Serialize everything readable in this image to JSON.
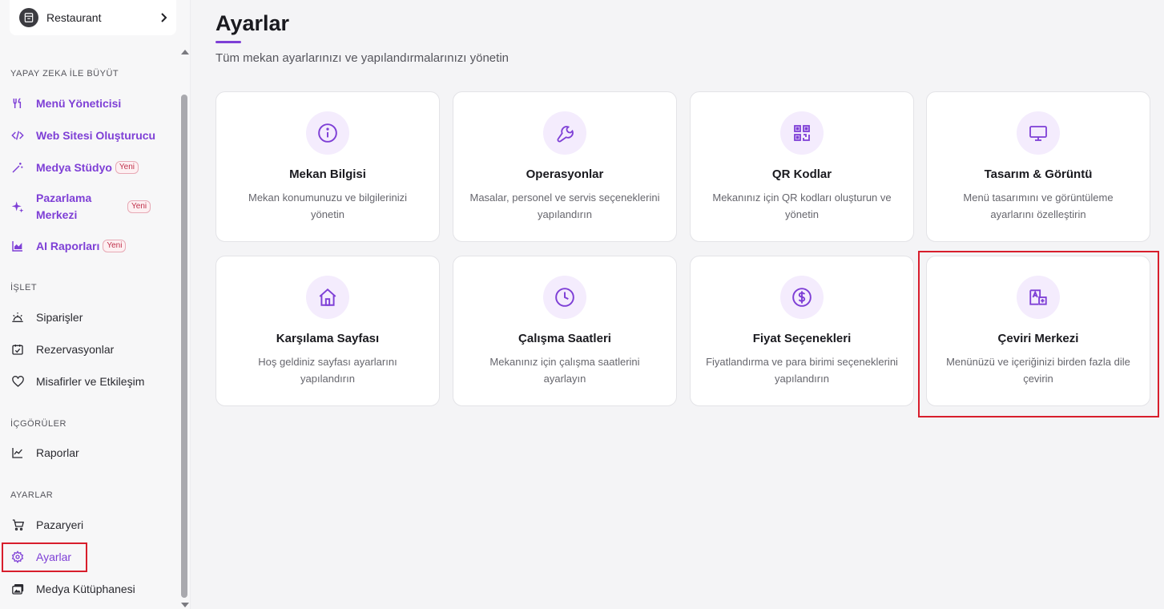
{
  "sidebar": {
    "venue_name": "Restaurant",
    "sections": {
      "ai": "YAPAY ZEKA İLE BÜYÜT",
      "operate": "İŞLET",
      "insights": "İÇGÖRÜLER",
      "settings": "AYARLAR"
    },
    "items": {
      "menu_manager": "Menü Yöneticisi",
      "website_builder": "Web Sitesi Oluşturucu",
      "media_studio": "Medya Stüdyo",
      "marketing_center": "Pazarlama Merkezi",
      "ai_reports": "AI Raporları",
      "orders": "Siparişler",
      "reservations": "Rezervasyonlar",
      "guests": "Misafirler ve Etkileşim",
      "reports": "Raporlar",
      "marketplace": "Pazaryeri",
      "settings": "Ayarlar",
      "media_library": "Medya Kütüphanesi"
    },
    "badge_new": "Yeni"
  },
  "main": {
    "title": "Ayarlar",
    "subtitle": "Tüm mekan ayarlarınızı ve yapılandırmalarınızı yönetin",
    "cards": [
      {
        "title": "Mekan Bilgisi",
        "desc": "Mekan konumunuzu ve bilgilerinizi yönetin",
        "icon": "info-icon"
      },
      {
        "title": "Operasyonlar",
        "desc": "Masalar, personel ve servis seçeneklerini yapılandırın",
        "icon": "wrench-icon"
      },
      {
        "title": "QR Kodlar",
        "desc": "Mekanınız için QR kodları oluşturun ve yönetin",
        "icon": "qr-code-icon"
      },
      {
        "title": "Tasarım & Görüntü",
        "desc": "Menü tasarımını ve görüntüleme ayarlarını özelleştirin",
        "icon": "monitor-icon"
      },
      {
        "title": "Karşılama Sayfası",
        "desc": "Hoş geldiniz sayfası ayarlarını yapılandırın",
        "icon": "home-icon"
      },
      {
        "title": "Çalışma Saatleri",
        "desc": "Mekanınız için çalışma saatlerini ayarlayın",
        "icon": "clock-icon"
      },
      {
        "title": "Fiyat Seçenekleri",
        "desc": "Fiyatlandırma ve para birimi seçeneklerini yapılandırın",
        "icon": "dollar-icon"
      },
      {
        "title": "Çeviri Merkezi",
        "desc": "Menünüzü ve içeriğinizi birden fazla dile çevirin",
        "icon": "translate-icon"
      }
    ]
  },
  "colors": {
    "accent": "#7e3fd6",
    "highlight": "#d81e2c",
    "icon_bg": "#f4ecfd"
  }
}
